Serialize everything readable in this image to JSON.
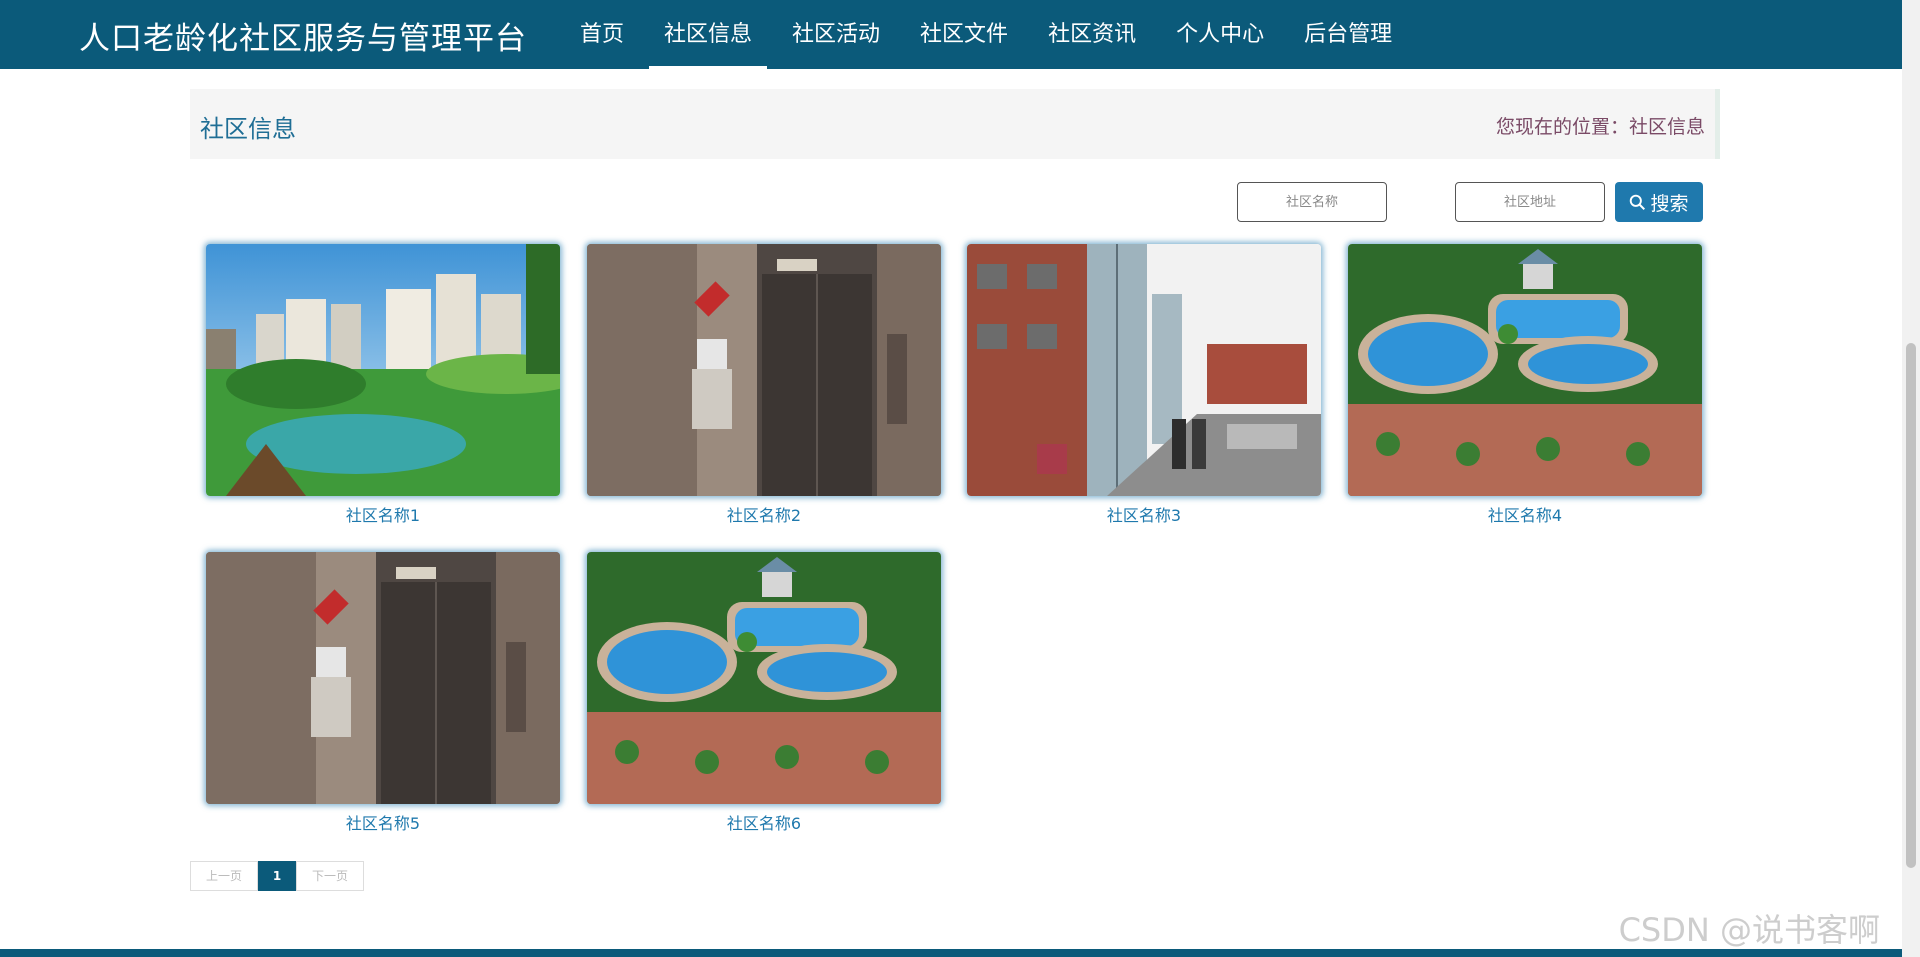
{
  "header": {
    "site_title": "人口老龄化社区服务与管理平台",
    "nav": [
      "首页",
      "社区信息",
      "社区活动",
      "社区文件",
      "社区资讯",
      "个人中心",
      "后台管理"
    ],
    "active_nav": "社区信息"
  },
  "page": {
    "title": "社区信息",
    "breadcrumb": "您现在的位置：社区信息"
  },
  "search": {
    "name_placeholder": "社区名称",
    "address_placeholder": "社区地址",
    "button_label": "搜索"
  },
  "cards": [
    {
      "name": "社区名称1",
      "image": "residential-garden"
    },
    {
      "name": "社区名称2",
      "image": "elevator-lobby"
    },
    {
      "name": "社区名称3",
      "image": "elevator-shaft-street"
    },
    {
      "name": "社区名称4",
      "image": "pool-courtyard"
    },
    {
      "name": "社区名称5",
      "image": "elevator-lobby"
    },
    {
      "name": "社区名称6",
      "image": "pool-courtyard"
    }
  ],
  "pagination": {
    "prev": "上一页",
    "current": "1",
    "next": "下一页"
  },
  "watermark": "CSDN @说书客啊",
  "colors": {
    "brand": "#0b5a7a",
    "accent": "#1f79ad"
  }
}
